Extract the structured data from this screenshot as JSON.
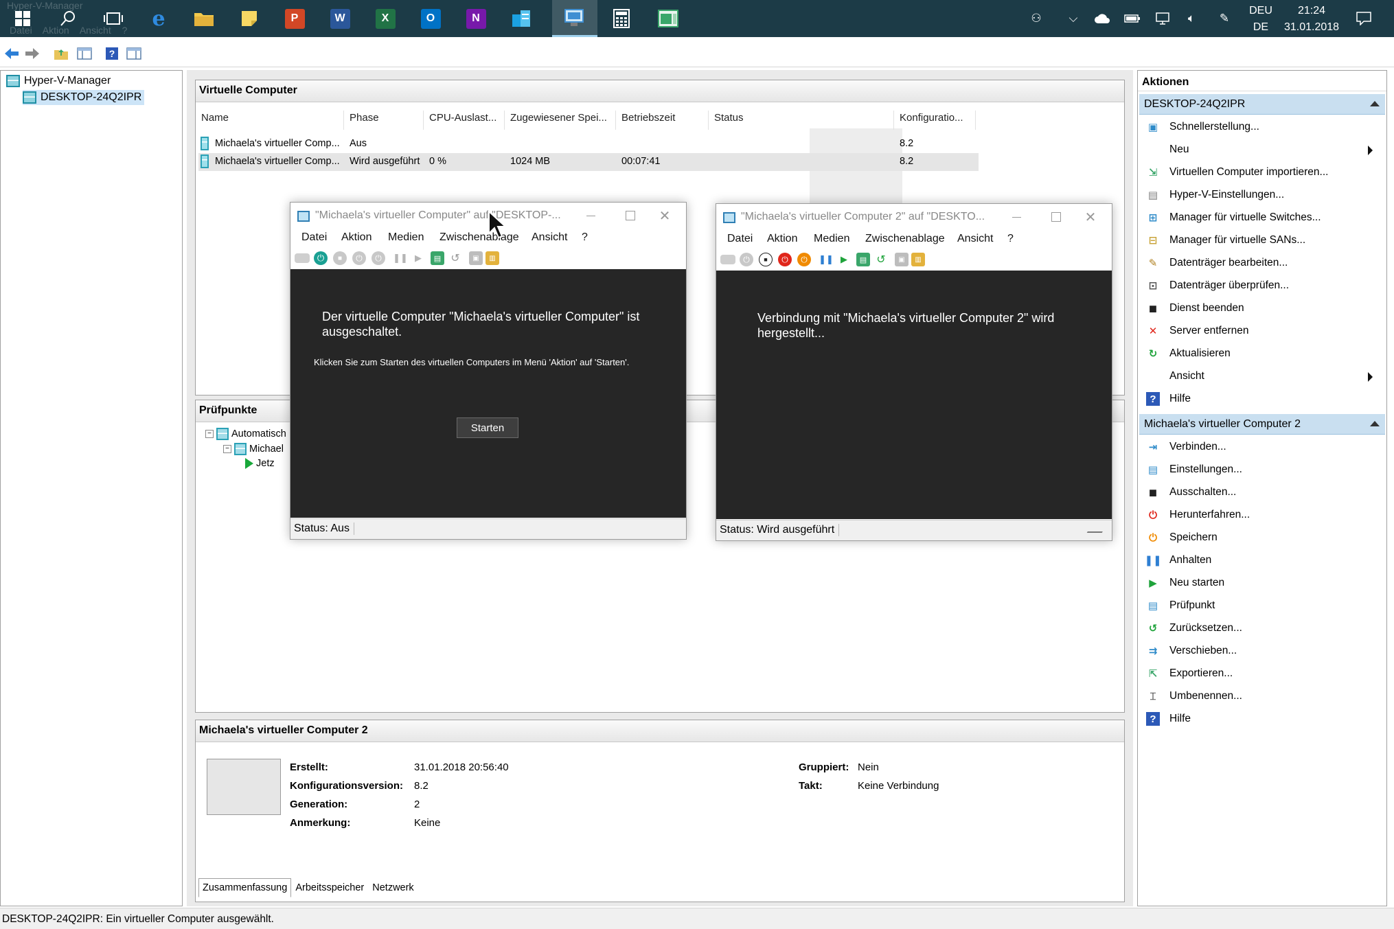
{
  "taskbar": {
    "ghost_title": "Hyper-V-Manager",
    "ghost_menu": "Datei Aktion Ansicht ?",
    "language_top": "DEU",
    "language_bottom": "DE",
    "time": "21:24",
    "date": "31.01.2018",
    "pinned_apps": [
      {
        "name": "windows-start",
        "label": ""
      },
      {
        "name": "search",
        "label": ""
      },
      {
        "name": "task-view",
        "label": ""
      },
      {
        "name": "edge",
        "label": "e",
        "color": "#1f74c9"
      },
      {
        "name": "file-explorer",
        "label": "",
        "color": "#f2c94c"
      },
      {
        "name": "sticky-notes",
        "label": "",
        "color": "#f7d864"
      },
      {
        "name": "powerpoint",
        "label": "P",
        "color": "#d24726"
      },
      {
        "name": "word",
        "label": "W",
        "color": "#2b579a"
      },
      {
        "name": "excel",
        "label": "X",
        "color": "#217346"
      },
      {
        "name": "outlook",
        "label": "O",
        "color": "#0072c6"
      },
      {
        "name": "onenote",
        "label": "N",
        "color": "#7719aa"
      },
      {
        "name": "azure-stack",
        "label": "",
        "color": "#1ba1e2"
      },
      {
        "name": "hyper-v-manager",
        "label": "",
        "color": "#3f8fd2"
      },
      {
        "name": "calculator",
        "label": "",
        "color": "#eeeeee"
      },
      {
        "name": "vm-connection",
        "label": "",
        "color": "#3aa66a"
      }
    ]
  },
  "tree": {
    "root": "Hyper-V-Manager",
    "server": "DESKTOP-24Q2IPR"
  },
  "vm_panel": {
    "title": "Virtuelle Computer",
    "columns": [
      "Name",
      "Phase",
      "CPU-Auslast...",
      "Zugewiesener Spei...",
      "Betriebszeit",
      "Status",
      "Konfiguratio..."
    ],
    "rows": [
      {
        "name": "Michaela's virtueller Comp...",
        "phase": "Aus",
        "cpu": "",
        "memory": "",
        "uptime": "",
        "status": "",
        "config": "8.2"
      },
      {
        "name": "Michaela's virtueller Comp...",
        "phase": "Wird ausgeführt",
        "cpu": "0 %",
        "memory": "1024 MB",
        "uptime": "00:07:41",
        "status": "",
        "config": "8.2"
      }
    ]
  },
  "checkpoints": {
    "title": "Prüfpunkte",
    "items": [
      "Automatisch",
      "Michael",
      "Jetz"
    ]
  },
  "summary": {
    "title": "Michaela's virtueller Computer 2",
    "fields_left": [
      {
        "label": "Erstellt:",
        "value": "31.01.2018 20:56:40"
      },
      {
        "label": "Konfigurationsversion:",
        "value": "8.2"
      },
      {
        "label": "Generation:",
        "value": "2"
      },
      {
        "label": "Anmerkung:",
        "value": "Keine"
      }
    ],
    "fields_right": [
      {
        "label": "Gruppiert:",
        "value": "Nein"
      },
      {
        "label": "Takt:",
        "value": "Keine Verbindung"
      }
    ],
    "tabs": [
      "Zusammenfassung",
      "Arbeitsspeicher",
      "Netzwerk"
    ]
  },
  "actions": {
    "title": "Aktionen",
    "section1": "DESKTOP-24Q2IPR",
    "items1": [
      {
        "label": "Schnellerstellung...",
        "icon": "quick-create-icon",
        "glyph": "▣",
        "color": "#2e8bc9"
      },
      {
        "label": "Neu",
        "icon": "",
        "glyph": "",
        "color": "#000",
        "submenu": true
      },
      {
        "label": "Virtuellen Computer importieren...",
        "icon": "import-icon",
        "glyph": "⇲",
        "color": "#3aa66a"
      },
      {
        "label": "Hyper-V-Einstellungen...",
        "icon": "settings-page-icon",
        "glyph": "▤",
        "color": "#7d7d7d"
      },
      {
        "label": "Manager für virtuelle Switches...",
        "icon": "switch-icon",
        "glyph": "⊞",
        "color": "#2e8bc9"
      },
      {
        "label": "Manager für virtuelle SANs...",
        "icon": "san-icon",
        "glyph": "⊟",
        "color": "#caa53c"
      },
      {
        "label": "Datenträger bearbeiten...",
        "icon": "edit-disk-icon",
        "glyph": "✎",
        "color": "#b08020"
      },
      {
        "label": "Datenträger überprüfen...",
        "icon": "inspect-disk-icon",
        "glyph": "⊡",
        "color": "#555555"
      },
      {
        "label": "Dienst beenden",
        "icon": "stop-service-icon",
        "glyph": "◼",
        "color": "#222222"
      },
      {
        "label": "Server entfernen",
        "icon": "remove-icon",
        "glyph": "✕",
        "color": "#e0261b"
      },
      {
        "label": "Aktualisieren",
        "icon": "refresh-icon",
        "glyph": "↻",
        "color": "#1fa33b"
      },
      {
        "label": "Ansicht",
        "icon": "",
        "glyph": "",
        "color": "#000",
        "submenu": true
      },
      {
        "label": "Hilfe",
        "icon": "help-icon",
        "glyph": "?",
        "color": "#2c59b7"
      }
    ],
    "section2": "Michaela's virtueller Computer 2",
    "items2": [
      {
        "label": "Verbinden...",
        "icon": "connect-icon",
        "glyph": "⇥",
        "color": "#2e8bc9"
      },
      {
        "label": "Einstellungen...",
        "icon": "settings-icon",
        "glyph": "▤",
        "color": "#2e8bc9"
      },
      {
        "label": "Ausschalten...",
        "icon": "turn-off-icon",
        "glyph": "◼",
        "color": "#222222"
      },
      {
        "label": "Herunterfahren...",
        "icon": "shutdown-icon",
        "glyph": "⏻",
        "color": "#e0261b"
      },
      {
        "label": "Speichern",
        "icon": "save-icon",
        "glyph": "⏻",
        "color": "#f08a00"
      },
      {
        "label": "Anhalten",
        "icon": "pause-icon",
        "glyph": "❚❚",
        "color": "#2e7fd2"
      },
      {
        "label": "Neu starten",
        "icon": "reset-icon",
        "glyph": "▶",
        "color": "#1fa33b"
      },
      {
        "label": "Prüfpunkt",
        "icon": "checkpoint-icon",
        "glyph": "▤",
        "color": "#2e8bc9"
      },
      {
        "label": "Zurücksetzen...",
        "icon": "revert-icon",
        "glyph": "↺",
        "color": "#1fa33b"
      },
      {
        "label": "Verschieben...",
        "icon": "move-icon",
        "glyph": "⇉",
        "color": "#2e8bc9"
      },
      {
        "label": "Exportieren...",
        "icon": "export-icon",
        "glyph": "⇱",
        "color": "#3aa66a"
      },
      {
        "label": "Umbenennen...",
        "icon": "rename-icon",
        "glyph": "⌶",
        "color": "#555555"
      },
      {
        "label": "Hilfe",
        "icon": "help-icon",
        "glyph": "?",
        "color": "#2c59b7"
      }
    ]
  },
  "statusbar": "DESKTOP-24Q2IPR:  Ein virtueller Computer ausgewählt.",
  "vmconnect1": {
    "title": "\"Michaela's virtueller Computer\" auf \"DESKTOP-...",
    "menu": [
      "Datei",
      "Aktion",
      "Medien",
      "Zwischenablage",
      "Ansicht",
      "?"
    ],
    "message": "Der virtuelle Computer \"Michaela's virtueller Computer\" ist ausgeschaltet.",
    "hint": "Klicken Sie zum Starten des virtuellen Computers im Menü 'Aktion' auf 'Starten'.",
    "start_button": "Starten",
    "status": "Status: Aus"
  },
  "vmconnect2": {
    "title": "\"Michaela's virtueller Computer 2\" auf \"DESKTO...",
    "menu": [
      "Datei",
      "Aktion",
      "Medien",
      "Zwischenablage",
      "Ansicht",
      "?"
    ],
    "message": "Verbindung mit \"Michaela's virtueller Computer 2\" wird hergestellt...",
    "status": "Status: Wird ausgeführt"
  }
}
